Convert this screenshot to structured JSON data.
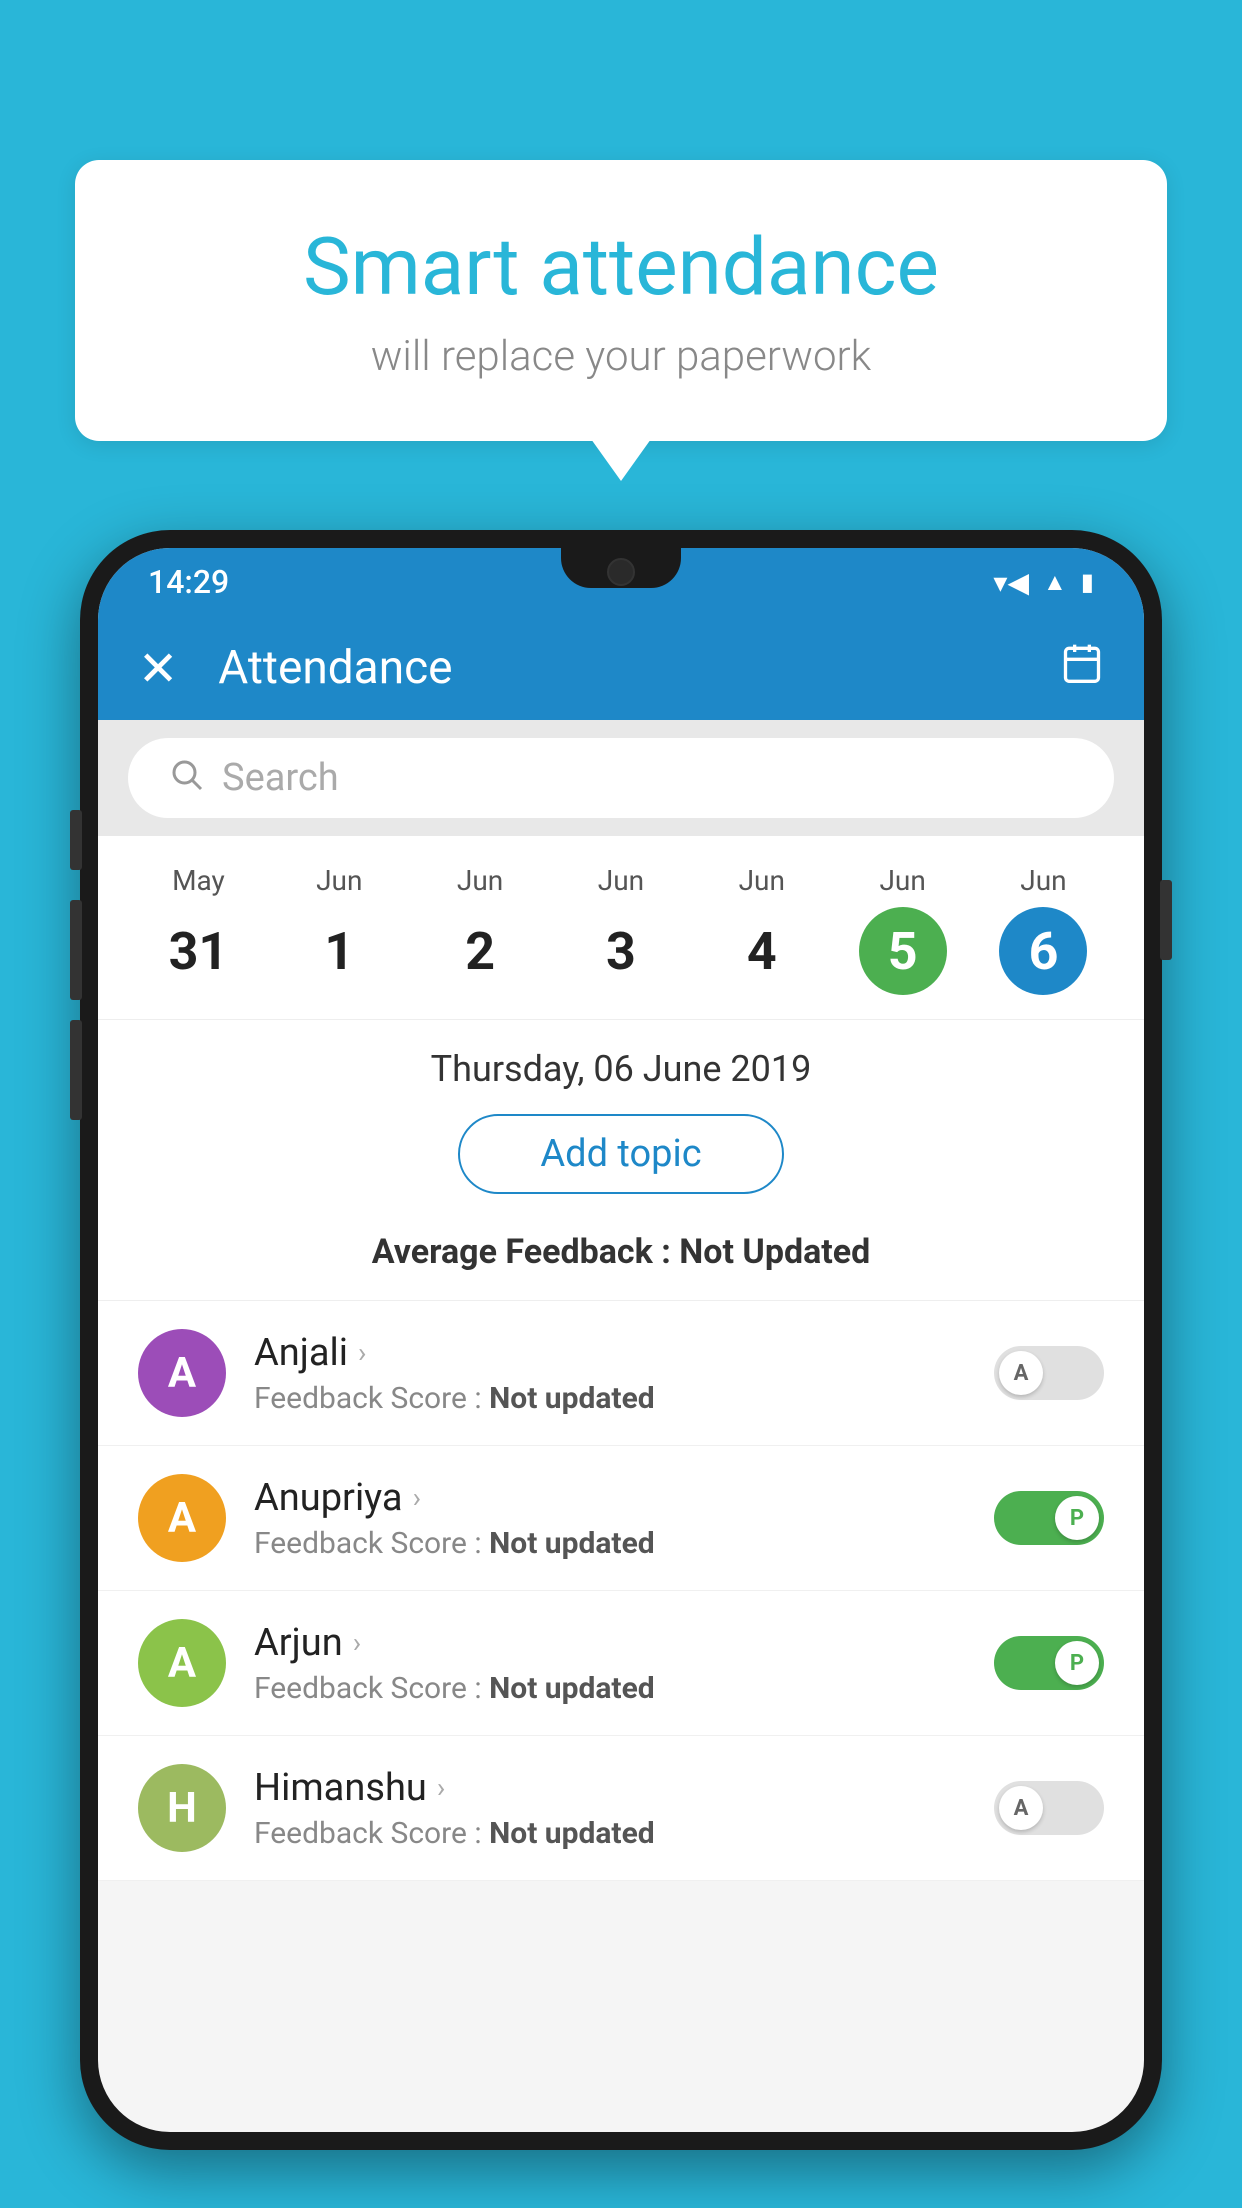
{
  "background_color": "#29b6d8",
  "bubble": {
    "title": "Smart attendance",
    "subtitle": "will replace your paperwork"
  },
  "status_bar": {
    "time": "14:29",
    "icons": [
      "wifi",
      "signal",
      "battery"
    ]
  },
  "app_bar": {
    "title": "Attendance",
    "close_label": "✕",
    "calendar_icon": "📅"
  },
  "search": {
    "placeholder": "Search"
  },
  "calendar": {
    "days": [
      {
        "month": "May",
        "date": "31",
        "style": "normal"
      },
      {
        "month": "Jun",
        "date": "1",
        "style": "normal"
      },
      {
        "month": "Jun",
        "date": "2",
        "style": "normal"
      },
      {
        "month": "Jun",
        "date": "3",
        "style": "normal"
      },
      {
        "month": "Jun",
        "date": "4",
        "style": "normal"
      },
      {
        "month": "Jun",
        "date": "5",
        "style": "green"
      },
      {
        "month": "Jun",
        "date": "6",
        "style": "blue"
      }
    ]
  },
  "selected_date": "Thursday, 06 June 2019",
  "add_topic_label": "Add topic",
  "average_feedback": {
    "label": "Average Feedback : ",
    "value": "Not Updated"
  },
  "students": [
    {
      "name": "Anjali",
      "avatar_letter": "A",
      "avatar_color": "#9c4db8",
      "score_label": "Feedback Score : ",
      "score_value": "Not updated",
      "toggle_state": "off",
      "toggle_letter": "A"
    },
    {
      "name": "Anupriya",
      "avatar_letter": "A",
      "avatar_color": "#f0a020",
      "score_label": "Feedback Score : ",
      "score_value": "Not updated",
      "toggle_state": "on",
      "toggle_letter": "P"
    },
    {
      "name": "Arjun",
      "avatar_letter": "A",
      "avatar_color": "#8bc34a",
      "score_label": "Feedback Score : ",
      "score_value": "Not updated",
      "toggle_state": "on",
      "toggle_letter": "P"
    },
    {
      "name": "Himanshu",
      "avatar_letter": "H",
      "avatar_color": "#9cba60",
      "score_label": "Feedback Score : ",
      "score_value": "Not updated",
      "toggle_state": "off",
      "toggle_letter": "A"
    }
  ]
}
